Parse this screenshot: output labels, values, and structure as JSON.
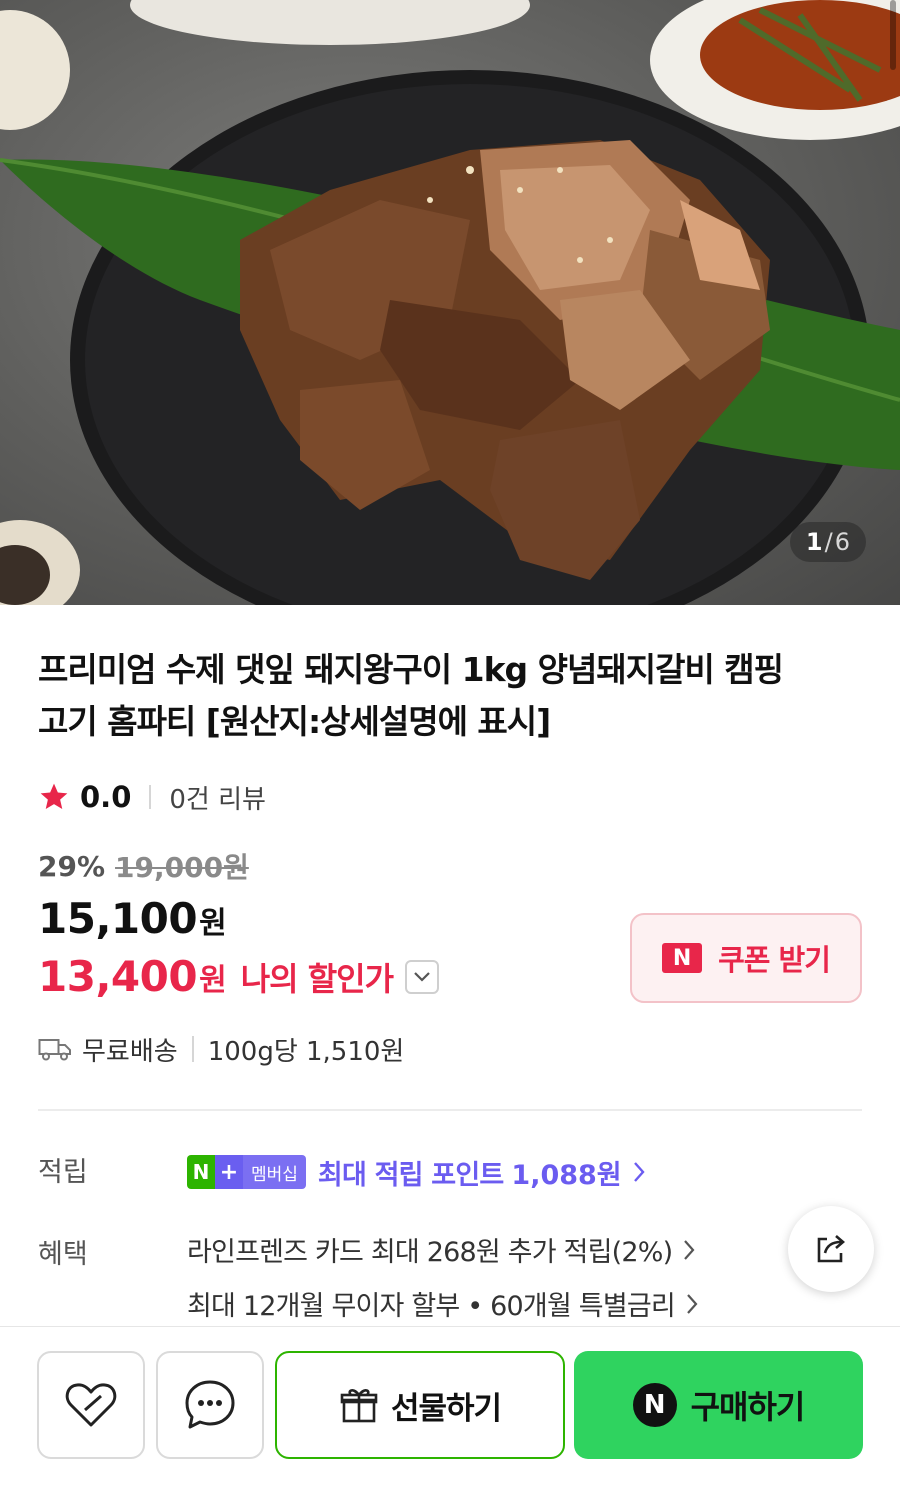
{
  "gallery": {
    "current": "1",
    "separator": "/",
    "total": "6"
  },
  "product": {
    "title": "프리미엄 수제 댓잎 돼지왕구이 1kg 양념돼지갈비 캠핑고기 홈파티 [원산지:상세설명에 표시]",
    "rating": "0.0",
    "review_count": "0건 리뷰",
    "discount_rate": "29%",
    "original_price": "19,000원",
    "price": "15,100",
    "price_unit": "원",
    "my_price": "13,400",
    "my_price_unit": "원",
    "my_price_label": "나의 할인가"
  },
  "coupon": {
    "badge": "N",
    "label": "쿠폰 받기"
  },
  "shipping": {
    "label": "무료배송",
    "unit_price": "100g당 1,510원"
  },
  "points": {
    "label": "적립",
    "badge_n": "N",
    "badge_plus": "+",
    "badge_membership": "멤버십",
    "text": "최대 적립 포인트",
    "amount": "1,088원"
  },
  "benefits": {
    "label": "혜택",
    "line1": "라인프렌즈 카드 최대 268원 추가 적립(2%)",
    "line2": "최대 12개월 무이자 할부 • 60개월 특별금리"
  },
  "bottom_bar": {
    "gift_label": "선물하기",
    "buy_badge": "N",
    "buy_label": "구매하기"
  },
  "colors": {
    "sale_red": "#e8264a",
    "naver_green": "#2db400",
    "buy_green": "#2fd35f",
    "membership_purple": "#6b5cf0"
  }
}
